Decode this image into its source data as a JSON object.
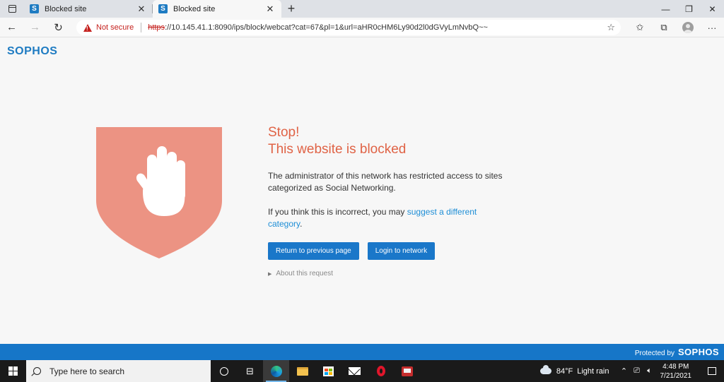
{
  "browser": {
    "tabs": [
      {
        "title": "Blocked site",
        "favicon": "S",
        "active": false
      },
      {
        "title": "Blocked site",
        "favicon": "S",
        "active": true
      }
    ],
    "new_tab_icon": "+",
    "close_icon": "✕",
    "security_label": "Not secure",
    "url_scheme": "https",
    "url_rest": "://10.145.41.1:8090/ips/block/webcat?cat=67&pl=1&url=aHR0cHM6Ly90d2l0dGVyLmNvbQ~~"
  },
  "page": {
    "logo": "SOPHOS",
    "stop": "Stop!",
    "heading": "This website is blocked",
    "p1": "The administrator of this network has restricted access to sites categorized as Social Networking.",
    "p2_prefix": "If you think this is incorrect, you may ",
    "p2_link": "suggest a different category",
    "p2_suffix": ".",
    "btn_return": "Return to previous page",
    "btn_login": "Login to network",
    "about": "About this request",
    "footer_label": "Protected by",
    "footer_brand": "SOPHOS"
  },
  "taskbar": {
    "search_placeholder": "Type here to search",
    "weather_temp": "84°F",
    "weather_desc": "Light rain",
    "time": "4:48 PM",
    "date": "7/21/2021"
  },
  "colors": {
    "brand_blue": "#1e7bc2",
    "stop_orange": "#e06346",
    "shield": "#ec9383",
    "button": "#1a77c9"
  }
}
